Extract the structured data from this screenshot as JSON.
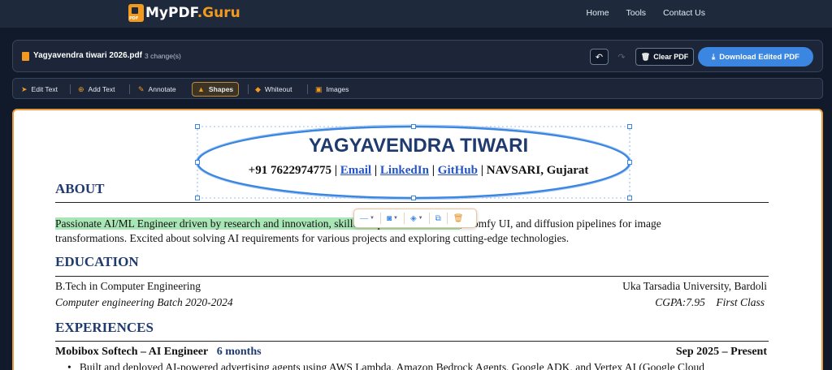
{
  "nav": {
    "logo_prefix": "MyPDF",
    "logo_suffix": ".Guru",
    "logo_badge": "PDF",
    "links": [
      "Home",
      "Tools",
      "Contact Us"
    ]
  },
  "file": {
    "name": "Yagyavendra tiwari 2026.pdf",
    "changes": "3 change(s)",
    "clear_label": "Clear PDF",
    "download_label": "Download Edited PDF"
  },
  "tools": {
    "edit_text": "Edit Text",
    "add_text": "Add Text",
    "annotate": "Annotate",
    "shapes": "Shapes",
    "whiteout": "Whiteout",
    "images": "Images",
    "active": "Shapes"
  },
  "resume": {
    "name": "YAGYAVENDRA TIWARI",
    "phone": "+91 7622974775",
    "sep": "|",
    "email": "Email",
    "linkedin": "LinkedIn",
    "github": "GitHub",
    "location": "NAVSARI, Gujarat",
    "about_heading": "ABOUT",
    "about_highlight": "Passionate AI/ML Engineer driven by research and innovation, skilled in pre-trained models",
    "about_rest1": ", Comfy UI, and diffusion pipelines for image",
    "about_line2": "transformations. Excited about solving AI requirements for various projects and exploring cutting-edge technologies.",
    "education_heading": "EDUCATION",
    "degree": "B.Tech in Computer Engineering",
    "university": "Uka Tarsadia University, Bardoli",
    "batch": "Computer engineering Batch 2020-2024",
    "cgpa": "CGPA:7.95",
    "class": "First Class",
    "experience_heading": "EXPERIENCES",
    "job_title": "Mobibox Softech – AI Engineer",
    "duration": "6 months",
    "job_dates": "Sep 2025 – Present",
    "bullet1": "Built and deployed AI-powered advertising agents using AWS Lambda, Amazon Bedrock Agents, Google ADK, and Vertex AI (Google Cloud"
  },
  "icons": {
    "undo": "undo-icon",
    "redo": "redo-icon",
    "trash": "trash-icon",
    "download": "download-icon",
    "line_style": "line-style-icon",
    "fill": "fill-icon",
    "paint": "paint-bucket-icon",
    "duplicate": "duplicate-icon",
    "delete": "delete-icon"
  },
  "colors": {
    "accent": "#f29a1f",
    "primary": "#3a86e0",
    "heading": "#1f3a6e",
    "highlight": "#a8e6b6"
  }
}
